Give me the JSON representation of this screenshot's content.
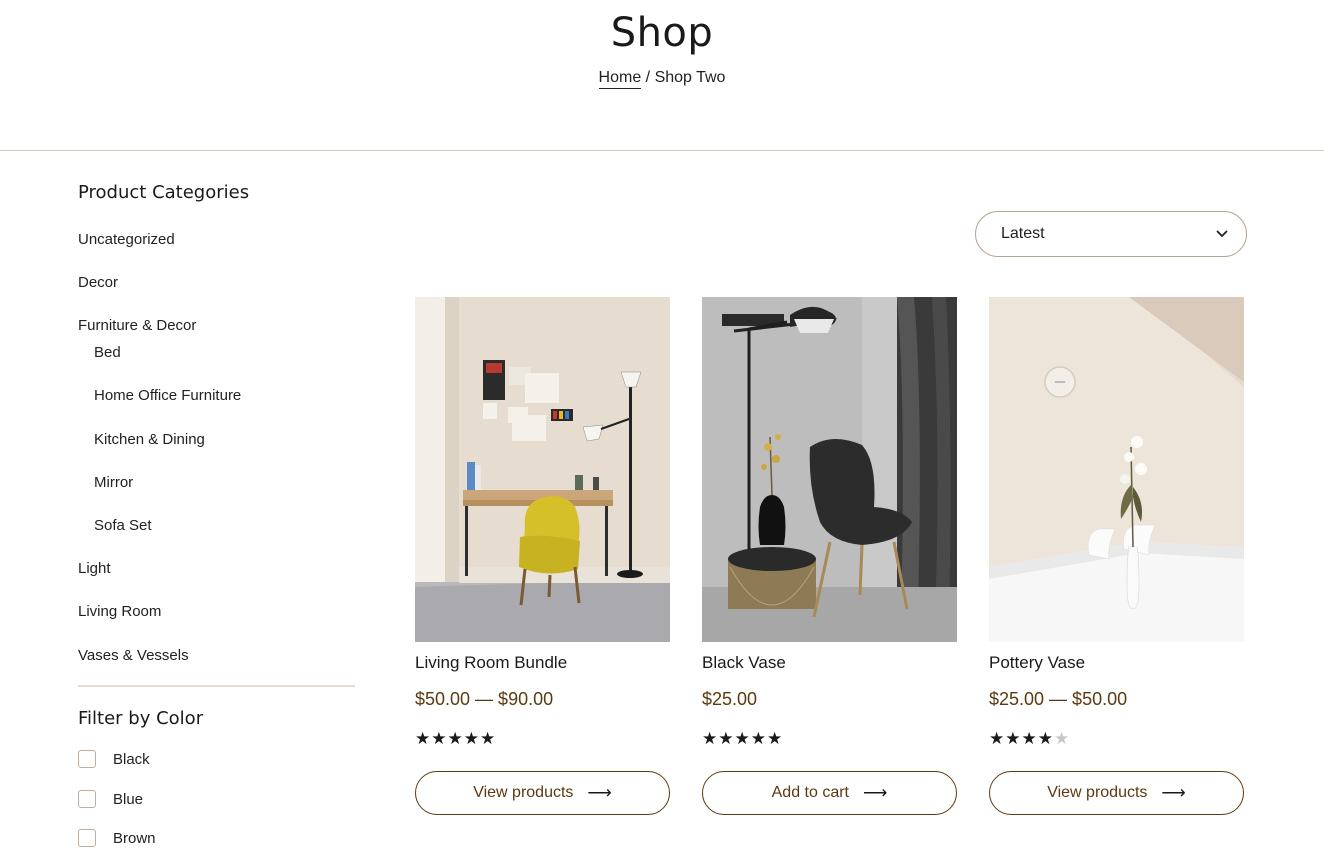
{
  "page": {
    "title": "Shop"
  },
  "breadcrumb": {
    "home": "Home",
    "separator": "/",
    "current": "Shop Two"
  },
  "sidebar": {
    "categories_heading": "Product Categories",
    "categories": [
      {
        "label": "Uncategorized",
        "level": 0
      },
      {
        "label": "Decor",
        "level": 0
      },
      {
        "label": "Furniture & Decor",
        "level": 0
      },
      {
        "label": "Bed",
        "level": 1
      },
      {
        "label": "Home Office Furniture",
        "level": 1
      },
      {
        "label": "Kitchen & Dining",
        "level": 1
      },
      {
        "label": "Mirror",
        "level": 1
      },
      {
        "label": "Sofa Set",
        "level": 1
      },
      {
        "label": "Light",
        "level": 0
      },
      {
        "label": "Living Room",
        "level": 0
      },
      {
        "label": "Vases & Vessels",
        "level": 0
      }
    ],
    "color_heading": "Filter by Color",
    "colors": [
      "Black",
      "Blue",
      "Brown"
    ]
  },
  "sort": {
    "selected": "Latest",
    "icon": "chevron-down-icon"
  },
  "products": [
    {
      "name": "Living Room Bundle",
      "price": "$50.00 — $90.00",
      "rating": 5,
      "button": "View products",
      "image": "desk-with-yellow-chair"
    },
    {
      "name": "Black Vase",
      "price": "$25.00",
      "rating": 5,
      "button": "Add to cart",
      "image": "black-chair-and-lamp"
    },
    {
      "name": "Pottery Vase",
      "price": "$25.00 — $50.00",
      "rating": 4,
      "button": "View products",
      "image": "white-vase-on-table"
    }
  ],
  "colors": {
    "accent": "#5a3a12",
    "divider": "#e9ddd0",
    "border": "#b4a695"
  }
}
